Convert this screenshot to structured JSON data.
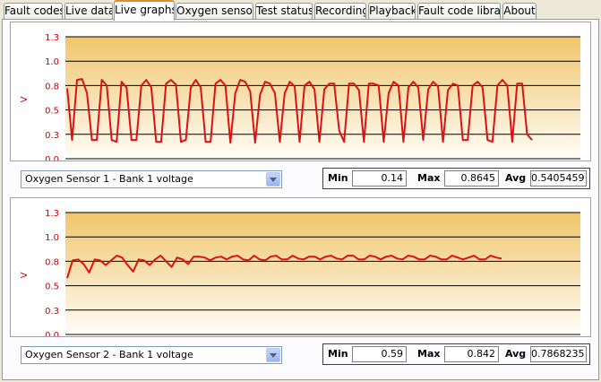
{
  "tabs": [
    {
      "label": "Fault codes",
      "active": false
    },
    {
      "label": "Live data",
      "active": false
    },
    {
      "label": "Live graphs",
      "active": true
    },
    {
      "label": "Oxygen sensors",
      "active": false
    },
    {
      "label": "Test status",
      "active": false
    },
    {
      "label": "Recording",
      "active": false
    },
    {
      "label": "Playback",
      "active": false
    },
    {
      "label": "Fault code library",
      "active": false
    },
    {
      "label": "About",
      "active": false
    }
  ],
  "graphs": [
    {
      "selected_sensor": "Oxygen Sensor 1 - Bank 1 voltage",
      "stats": {
        "min_label": "Min",
        "min": "0.14",
        "max_label": "Max",
        "max": "0.8645",
        "avg_label": "Avg",
        "avg": "0.5405459"
      },
      "chart_data": {
        "type": "line",
        "ylabel": "V",
        "ylim": [
          0,
          1.3
        ],
        "yticks": [
          "0.0",
          "0.3",
          "0.5",
          "0.8",
          "1.0",
          "1.3"
        ],
        "line_color": "#dd1111",
        "values": [
          0.75,
          0.2,
          0.84,
          0.85,
          0.7,
          0.2,
          0.2,
          0.84,
          0.78,
          0.2,
          0.18,
          0.82,
          0.76,
          0.2,
          0.2,
          0.78,
          0.84,
          0.76,
          0.18,
          0.18,
          0.8,
          0.84,
          0.79,
          0.18,
          0.2,
          0.76,
          0.84,
          0.76,
          0.18,
          0.18,
          0.8,
          0.84,
          0.78,
          0.17,
          0.7,
          0.84,
          0.82,
          0.72,
          0.17,
          0.68,
          0.82,
          0.8,
          0.7,
          0.18,
          0.7,
          0.82,
          0.77,
          0.18,
          0.78,
          0.82,
          0.74,
          0.18,
          0.74,
          0.8,
          0.8,
          0.3,
          0.18,
          0.8,
          0.8,
          0.73,
          0.18,
          0.8,
          0.8,
          0.78,
          0.18,
          0.7,
          0.82,
          0.78,
          0.18,
          0.76,
          0.82,
          0.76,
          0.2,
          0.74,
          0.82,
          0.77,
          0.18,
          0.73,
          0.8,
          0.78,
          0.2,
          0.2,
          0.78,
          0.82,
          0.76,
          0.2,
          0.18,
          0.78,
          0.84,
          0.78,
          0.18,
          0.8,
          0.8,
          0.26,
          0.2
        ],
        "background_gradient": [
          "#fffdf8",
          "#f0c66c"
        ]
      }
    },
    {
      "selected_sensor": "Oxygen Sensor 2 - Bank 1 voltage",
      "stats": {
        "min_label": "Min",
        "min": "0.59",
        "max_label": "Max",
        "max": "0.842",
        "avg_label": "Avg",
        "avg": "0.7868235"
      },
      "chart_data": {
        "type": "line",
        "ylabel": "V",
        "ylim": [
          0,
          1.3
        ],
        "yticks": [
          "0.0",
          "0.3",
          "0.5",
          "0.8",
          "1.0",
          "1.3"
        ],
        "line_color": "#dd1111",
        "values": [
          0.6,
          0.79,
          0.8,
          0.75,
          0.66,
          0.8,
          0.79,
          0.74,
          0.79,
          0.84,
          0.82,
          0.74,
          0.67,
          0.8,
          0.79,
          0.74,
          0.8,
          0.84,
          0.78,
          0.72,
          0.82,
          0.8,
          0.75,
          0.83,
          0.83,
          0.82,
          0.79,
          0.82,
          0.83,
          0.8,
          0.83,
          0.84,
          0.8,
          0.79,
          0.84,
          0.8,
          0.79,
          0.83,
          0.84,
          0.8,
          0.8,
          0.84,
          0.81,
          0.8,
          0.83,
          0.83,
          0.8,
          0.83,
          0.84,
          0.81,
          0.8,
          0.84,
          0.84,
          0.8,
          0.8,
          0.84,
          0.83,
          0.8,
          0.83,
          0.84,
          0.81,
          0.8,
          0.84,
          0.83,
          0.8,
          0.8,
          0.84,
          0.83,
          0.8,
          0.8,
          0.84,
          0.82,
          0.8,
          0.82,
          0.84,
          0.8,
          0.8,
          0.84,
          0.82,
          0.81
        ],
        "background_gradient": [
          "#fffdf8",
          "#f0c66c"
        ]
      }
    }
  ]
}
